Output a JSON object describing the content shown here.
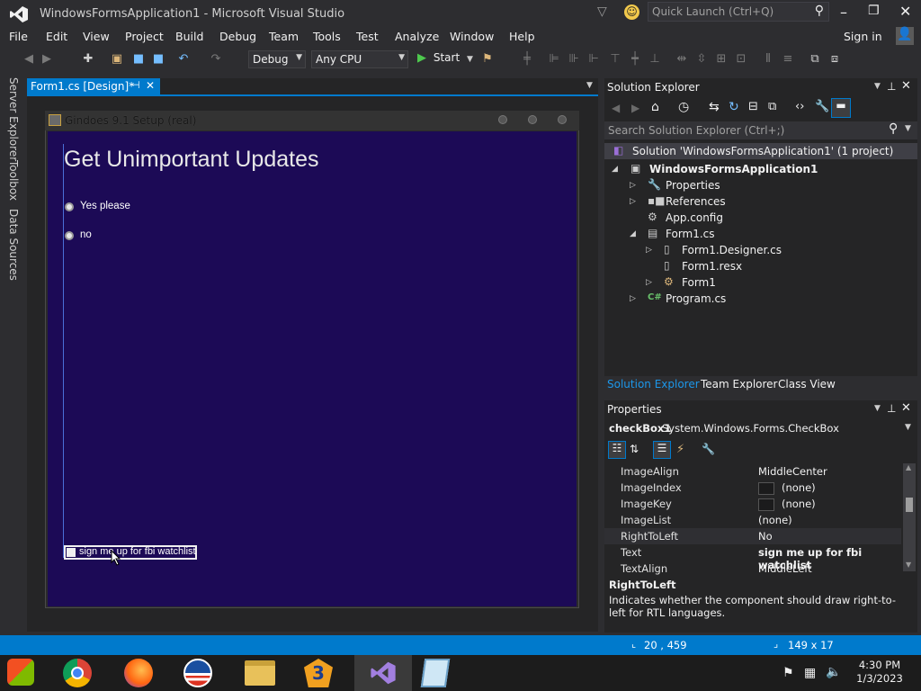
{
  "window": {
    "title": "WindowsFormsApplication1 - Microsoft Visual Studio",
    "quick_launch_placeholder": "Quick Launch (Ctrl+Q)"
  },
  "menu": [
    "File",
    "Edit",
    "View",
    "Project",
    "Build",
    "Debug",
    "Team",
    "Tools",
    "Test",
    "Analyze",
    "Window",
    "Help"
  ],
  "sign_in": "Sign in",
  "toolbar": {
    "config": "Debug",
    "platform": "Any CPU",
    "start": "Start"
  },
  "left_tabs": [
    "Server Explorer",
    "Toolbox",
    "Data Sources"
  ],
  "doc_tab": "Form1.cs [Design]*",
  "form": {
    "title": "Gindoes 9.1 Setup (real)",
    "heading": "Get Unimportant Updates",
    "radio1": "Yes please",
    "radio2": "no",
    "checkbox": "sign me up for fbi watchlist"
  },
  "solution_explorer": {
    "title": "Solution Explorer",
    "search_placeholder": "Search Solution Explorer (Ctrl+;)",
    "items": [
      "Solution 'WindowsFormsApplication1' (1 project)",
      "WindowsFormsApplication1",
      "Properties",
      "References",
      "App.config",
      "Form1.cs",
      "Form1.Designer.cs",
      "Form1.resx",
      "Form1",
      "Program.cs"
    ],
    "bottom_tabs": [
      "Solution Explorer",
      "Team Explorer",
      "Class View"
    ]
  },
  "properties": {
    "title": "Properties",
    "object": "checkBox1",
    "object_type": "System.Windows.Forms.CheckBox",
    "rows": [
      {
        "name": "ImageAlign",
        "value": "MiddleCenter"
      },
      {
        "name": "ImageIndex",
        "value": "(none)"
      },
      {
        "name": "ImageKey",
        "value": "(none)"
      },
      {
        "name": "ImageList",
        "value": "(none)"
      },
      {
        "name": "RightToLeft",
        "value": "No"
      },
      {
        "name": "Text",
        "value": "sign me up for fbi watchlist"
      },
      {
        "name": "TextAlign",
        "value": "MiddleLeft"
      }
    ],
    "desc_title": "RightToLeft",
    "desc_text": "Indicates whether the component should draw right-to-left for RTL languages."
  },
  "status": {
    "position": "20 , 459",
    "size": "149 x 17"
  },
  "tray": {
    "time": "4:30 PM",
    "date": "1/3/2023"
  },
  "colors": {
    "accent": "#007acc",
    "form_bg": "#1c0a56",
    "chrome": "#2d2d30"
  }
}
